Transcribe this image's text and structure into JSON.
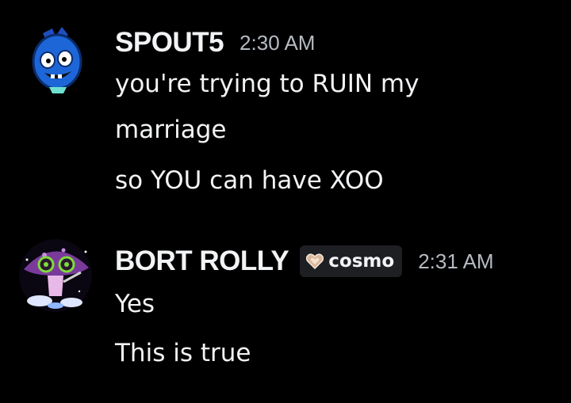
{
  "messages": [
    {
      "username": "SPOUT5",
      "timestamp": "2:30 AM",
      "lines": [
        "you're trying to RUIN my",
        "marriage",
        "so YOU can have XOO"
      ],
      "avatar_icon": "blue-cartoon-creature-avatar"
    },
    {
      "username": "BORT ROLLY",
      "tag": {
        "icon": "heart-icon",
        "label": "cosmo"
      },
      "timestamp": "2:31 AM",
      "lines": [
        "Yes",
        "This is true"
      ],
      "avatar_icon": "purple-mushroom-creature-avatar"
    }
  ],
  "colors": {
    "background": "#000000",
    "text": "#f2f3f5",
    "muted": "#b5bac1",
    "tag_bg": "#1e1f22"
  }
}
